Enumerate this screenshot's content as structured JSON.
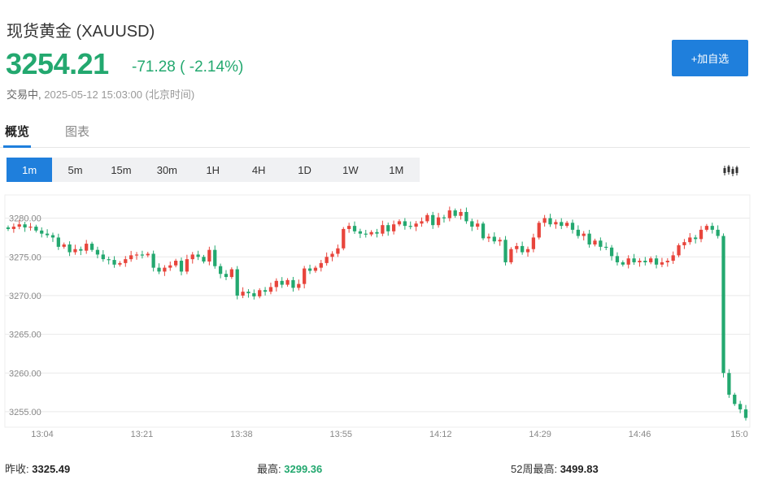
{
  "header": {
    "title": "现货黄金 (XAUUSD)",
    "price": "3254.21",
    "change": "-71.28 ( -2.14%)",
    "status_label": "交易中,",
    "timestamp": "2025-05-12 15:03:00 (北京时间)",
    "add_button": "+加自选"
  },
  "tabs": [
    {
      "label": "概览",
      "active": true
    },
    {
      "label": "图表",
      "active": false
    }
  ],
  "intervals": [
    {
      "label": "1m",
      "active": true
    },
    {
      "label": "5m",
      "active": false
    },
    {
      "label": "15m",
      "active": false
    },
    {
      "label": "30m",
      "active": false
    },
    {
      "label": "1H",
      "active": false
    },
    {
      "label": "4H",
      "active": false
    },
    {
      "label": "1D",
      "active": false
    },
    {
      "label": "1W",
      "active": false
    },
    {
      "label": "1M",
      "active": false
    }
  ],
  "chart_type_icon": "candlestick-icon",
  "colors": {
    "up": "#e8453c",
    "down": "#23a86f",
    "accent": "#1f7fdc",
    "grid": "#e9e9e9"
  },
  "chart_data": {
    "type": "candlestick",
    "ylim": [
      3253,
      3283
    ],
    "yticks": [
      "3280.00",
      "3275.00",
      "3270.00",
      "3265.00",
      "3260.00",
      "3255.00"
    ],
    "ytick_values": [
      3280,
      3275,
      3270,
      3265,
      3260,
      3255
    ],
    "xticks": [
      "13:04",
      "13:21",
      "13:38",
      "13:55",
      "14:12",
      "14:29",
      "14:46",
      "15:0"
    ],
    "grid": true,
    "close_series": [
      3278.6,
      3278.9,
      3279.2,
      3278.8,
      3278.9,
      3278.4,
      3278.0,
      3277.8,
      3277.5,
      3276.3,
      3276.6,
      3275.6,
      3276.0,
      3275.8,
      3276.7,
      3275.9,
      3275.3,
      3274.7,
      3274.6,
      3274.0,
      3274.2,
      3274.7,
      3275.2,
      3275.3,
      3275.2,
      3275.4,
      3273.6,
      3273.1,
      3273.6,
      3273.9,
      3274.5,
      3273.1,
      3274.7,
      3275.3,
      3275.0,
      3274.4,
      3275.9,
      3273.8,
      3272.8,
      3272.4,
      3273.4,
      3270.0,
      3270.5,
      3270.3,
      3269.9,
      3270.7,
      3270.5,
      3271.1,
      3271.9,
      3271.4,
      3272.0,
      3271.0,
      3271.5,
      3273.5,
      3273.2,
      3273.6,
      3274.2,
      3275.0,
      3275.4,
      3276.1,
      3278.6,
      3279.0,
      3278.3,
      3278.0,
      3277.9,
      3278.2,
      3278.0,
      3279.1,
      3278.3,
      3279.2,
      3279.6,
      3279.0,
      3278.9,
      3279.3,
      3279.6,
      3280.4,
      3279.1,
      3280.1,
      3280.0,
      3281.0,
      3280.3,
      3280.8,
      3279.6,
      3278.9,
      3279.3,
      3277.4,
      3277.6,
      3277.0,
      3277.2,
      3274.3,
      3276.0,
      3276.4,
      3275.6,
      3276.0,
      3277.5,
      3279.4,
      3280.0,
      3279.2,
      3279.5,
      3279.0,
      3279.4,
      3278.5,
      3277.7,
      3278.0,
      3276.6,
      3277.1,
      3276.3,
      3276.2,
      3275.1,
      3274.3,
      3274.0,
      3274.8,
      3274.3,
      3274.5,
      3274.3,
      3274.8,
      3274.0,
      3274.3,
      3274.5,
      3275.2,
      3276.5,
      3276.9,
      3277.5,
      3277.3,
      3278.5,
      3279.0,
      3278.5,
      3277.7,
      3260.0,
      3257.2,
      3256.0,
      3255.3,
      3254.2
    ]
  },
  "stats": {
    "prev_close_label": "昨收:",
    "prev_close_value": "3325.49",
    "high_label": "最高:",
    "high_value": "3299.36",
    "high52_label": "52周最高:",
    "high52_value": "3499.83"
  }
}
